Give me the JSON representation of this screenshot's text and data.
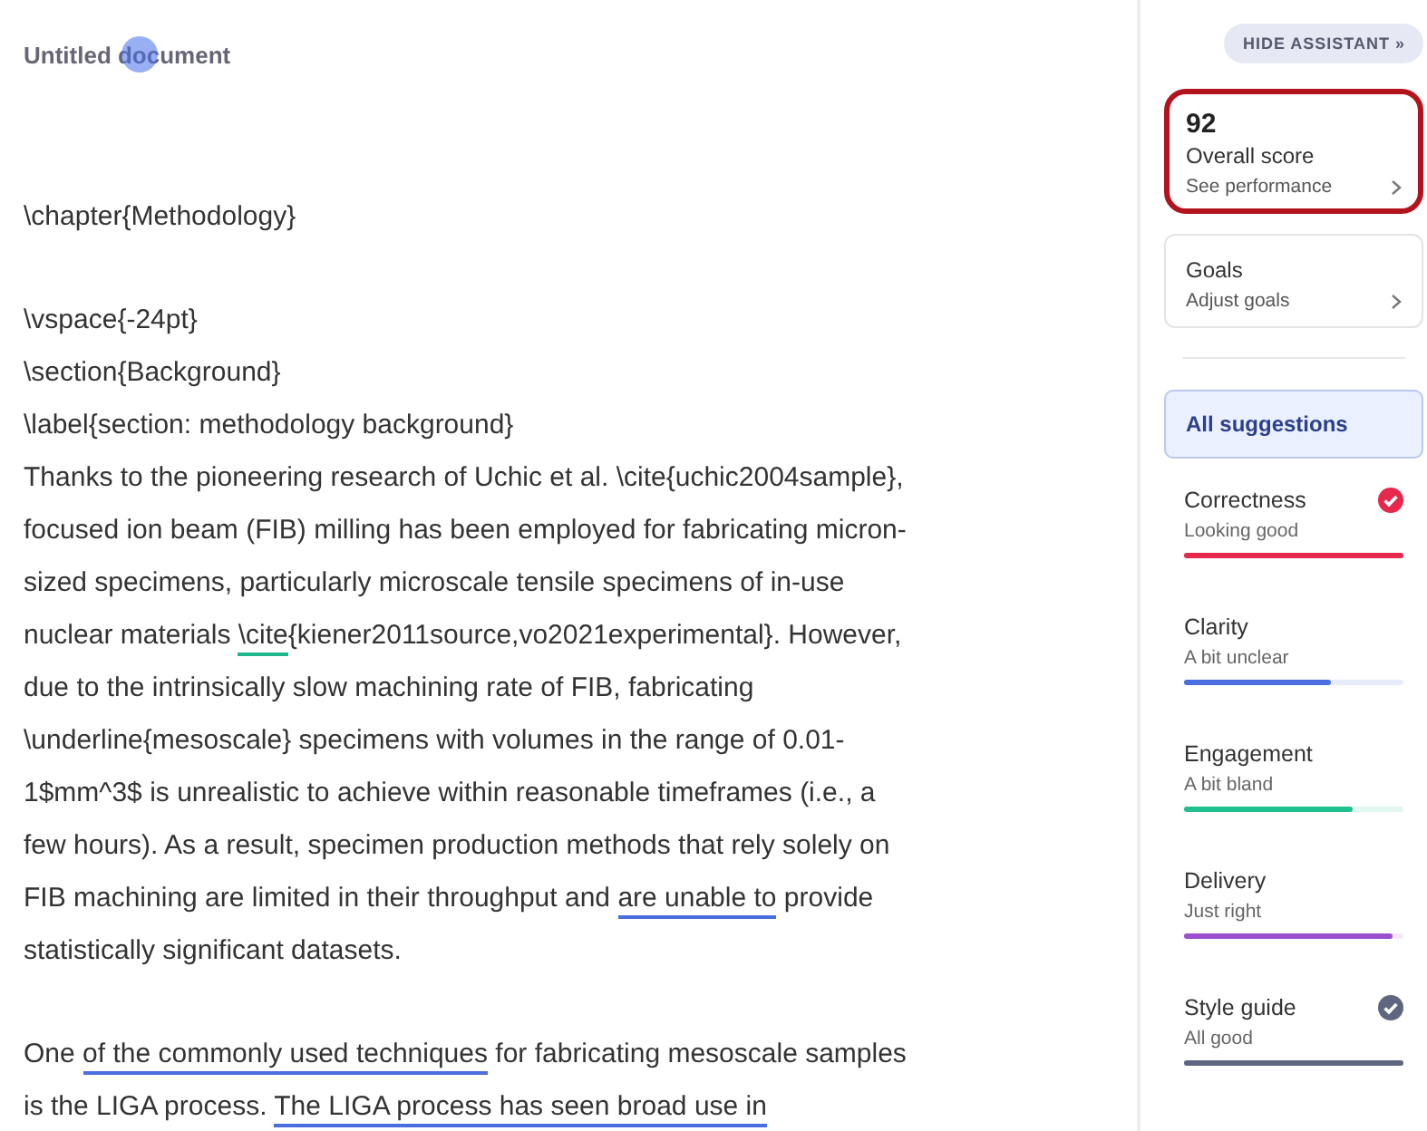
{
  "document": {
    "title": "Untitled document",
    "paragraphs": [
      {
        "lines": [
          [
            {
              "text": "\\chapter{Methodology}"
            }
          ]
        ]
      },
      {
        "lines": [
          [
            {
              "text": "\\vspace{-24pt}"
            }
          ],
          [
            {
              "text": "\\section{Background}"
            }
          ],
          [
            {
              "text": "\\label{section: methodology background}"
            }
          ],
          [
            {
              "text": "Thanks to the pioneering research of Uchic et al. \\cite{uchic2004sample},"
            }
          ],
          [
            {
              "text": "focused ion beam (FIB) milling has been employed for fabricating micron-"
            }
          ],
          [
            {
              "text": "sized specimens, particularly microscale tensile specimens of in-use"
            }
          ],
          [
            {
              "text": "nuclear materials "
            },
            {
              "text": "\\cite",
              "color": "#1fb58f"
            },
            {
              "text": "{kiener2011source,vo2021experimental}. However,"
            }
          ],
          [
            {
              "text": "due to the intrinsically slow machining rate of FIB, fabricating"
            }
          ],
          [
            {
              "text": "\\underline{mesoscale} specimens with volumes in the range of 0.01-"
            }
          ],
          [
            {
              "text": "1$mm^3$ is unrealistic to achieve within reasonable timeframes (i.e., a"
            }
          ],
          [
            {
              "text": "few hours). As a result, specimen production methods that rely solely on"
            }
          ],
          [
            {
              "text": "FIB machining are limited in their throughput and "
            },
            {
              "text": "are unable to",
              "color": "#4a6ee0"
            },
            {
              "text": " provide"
            }
          ],
          [
            {
              "text": "statistically significant datasets."
            }
          ]
        ]
      },
      {
        "lines": [
          [
            {
              "text": "One "
            },
            {
              "text": "of the commonly used techniques",
              "color": "#4a6ee0"
            },
            {
              "text": " for fabricating mesoscale samples"
            }
          ],
          [
            {
              "text": "is the LIGA process. "
            },
            {
              "text": "The LIGA process has seen broad use in",
              "color": "#4a6ee0"
            }
          ]
        ]
      }
    ]
  },
  "assistant": {
    "hide_button": "HIDE ASSISTANT",
    "hide_icon": "»",
    "score": {
      "value": "92",
      "label": "Overall score",
      "link": "See performance",
      "highlighted": true
    },
    "goals": {
      "label": "Goals",
      "link": "Adjust goals"
    },
    "all_suggestions": {
      "label": "All suggestions",
      "selected": true
    },
    "categories": [
      {
        "name": "Correctness",
        "status": "Looking good",
        "level": 1.0,
        "color": "#e5284b",
        "done": true
      },
      {
        "name": "Clarity",
        "status": "A bit unclear",
        "level": 0.67,
        "color": "#4a6ee0",
        "done": false
      },
      {
        "name": "Engagement",
        "status": "A bit bland",
        "level": 0.77,
        "color": "#20c08f",
        "done": false
      },
      {
        "name": "Delivery",
        "status": "Just right",
        "level": 0.95,
        "color": "#9b4fcf",
        "done": false
      },
      {
        "name": "Style guide",
        "status": "All good",
        "level": 1.0,
        "color": "#5f6680",
        "done": true
      }
    ]
  }
}
